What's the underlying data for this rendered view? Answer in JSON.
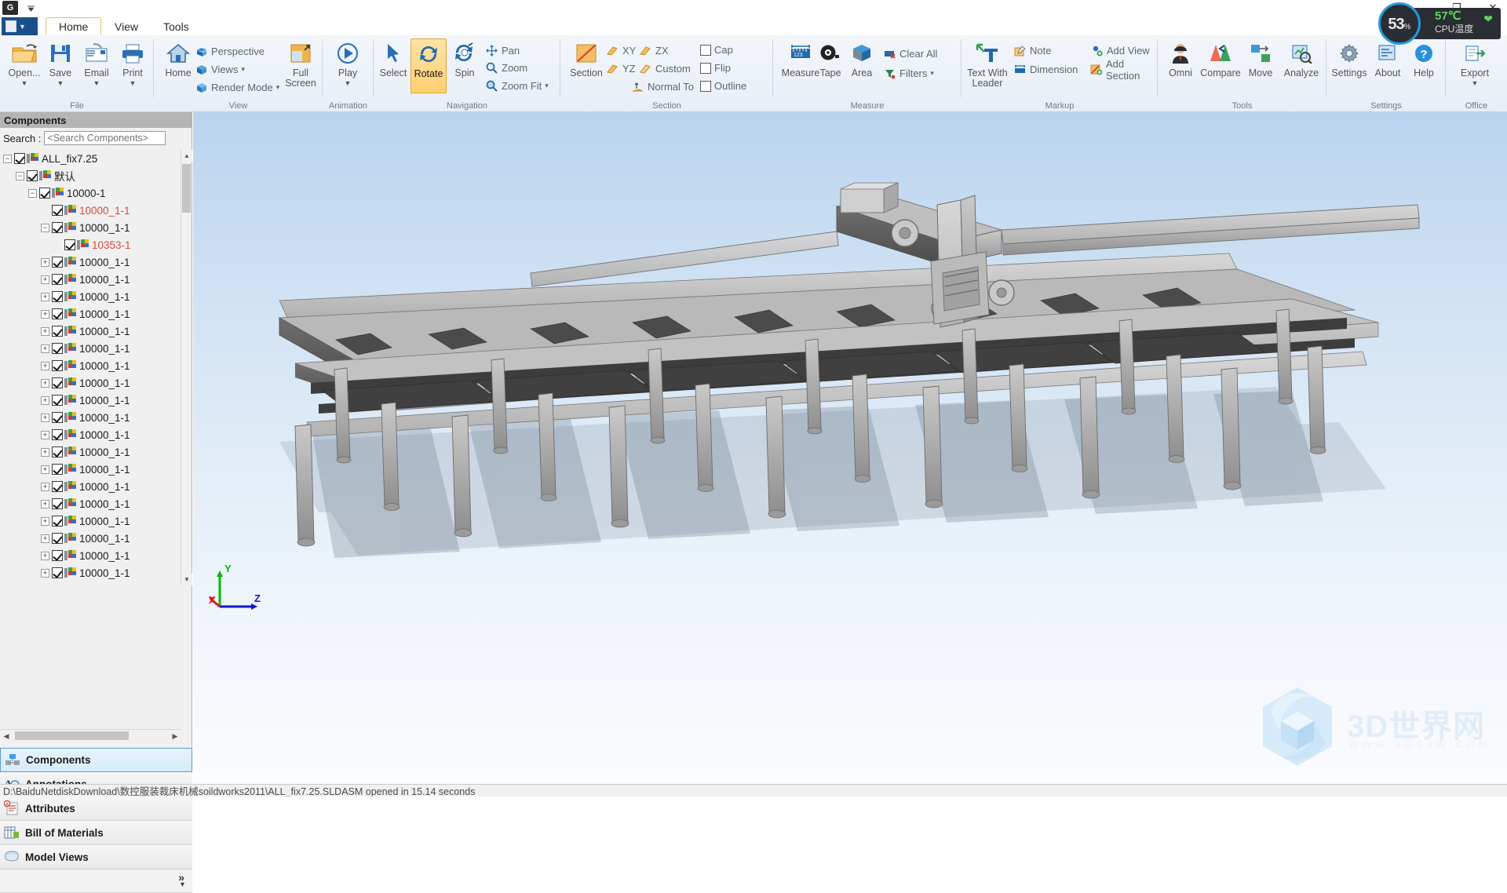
{
  "titlebar": {
    "app_menu_icon": "app-menu-icon",
    "qat_dropdown_icon": "chevron-down-icon",
    "minimize": "—",
    "maximize": "❐",
    "close": "✕"
  },
  "cpu_widget": {
    "percent": "53",
    "percent_symbol": "%",
    "temperature": "57℃",
    "label": "CPU温度",
    "leaf_icon": "leaf-icon",
    "ring_color": "#1f9bde",
    "temp_color": "#5fd35f"
  },
  "tabs": [
    {
      "label": "Home",
      "active": true
    },
    {
      "label": "View",
      "active": false
    },
    {
      "label": "Tools",
      "active": false
    }
  ],
  "ribbon": {
    "groups": [
      {
        "name": "File",
        "label": "File",
        "big_buttons": [
          {
            "label": "Open...",
            "icon": "open-folder-icon",
            "caret": "▼"
          },
          {
            "label": "Save",
            "icon": "save-disk-icon",
            "caret": "▼"
          },
          {
            "label": "Email",
            "icon": "email-icon",
            "caret": "▼"
          },
          {
            "label": "Print",
            "icon": "printer-icon",
            "caret": "▼"
          }
        ]
      },
      {
        "name": "View",
        "label": "View",
        "big_buttons": [
          {
            "label": "Home",
            "icon": "home-icon",
            "caret": ""
          },
          {
            "label": "Full Screen",
            "icon": "fullscreen-icon",
            "caret": ""
          }
        ],
        "small_buttons": [
          {
            "label": "Perspective",
            "icon": "perspective-icon",
            "caret": ""
          },
          {
            "label": "Views",
            "icon": "views-cube-icon",
            "caret": "▾"
          },
          {
            "label": "Render Mode",
            "icon": "render-mode-icon",
            "caret": "▾"
          }
        ]
      },
      {
        "name": "Animation",
        "label": "Animation",
        "big_buttons": [
          {
            "label": "Play",
            "icon": "play-icon",
            "caret": "▼"
          }
        ]
      },
      {
        "name": "Navigation",
        "label": "Navigation",
        "big_buttons": [
          {
            "label": "Select",
            "icon": "cursor-arrow-icon",
            "caret": "",
            "active": false
          },
          {
            "label": "Rotate",
            "icon": "rotate-icon",
            "caret": "",
            "active": true
          },
          {
            "label": "Spin",
            "icon": "spin-icon",
            "caret": "",
            "active": false
          }
        ],
        "small_buttons": [
          {
            "label": "Pan",
            "icon": "pan-icon",
            "caret": ""
          },
          {
            "label": "Zoom",
            "icon": "zoom-icon",
            "caret": ""
          },
          {
            "label": "Zoom Fit",
            "icon": "zoom-fit-icon",
            "caret": "▾"
          }
        ]
      },
      {
        "name": "Section",
        "label": "Section",
        "big_buttons": [
          {
            "label": "Section",
            "icon": "section-plane-icon",
            "caret": ""
          }
        ],
        "small_buttons": [
          {
            "label": "XY",
            "icon": "plane-xy-icon",
            "caret": ""
          },
          {
            "label": "ZX",
            "icon": "plane-zx-icon",
            "caret": ""
          },
          {
            "label": "YZ",
            "icon": "plane-yz-icon",
            "caret": ""
          },
          {
            "label": "Custom",
            "icon": "plane-custom-icon",
            "caret": ""
          },
          {
            "label": "Normal To",
            "icon": "normal-to-icon",
            "caret": ""
          }
        ],
        "checkboxes": [
          {
            "label": "Cap",
            "checked": false
          },
          {
            "label": "Flip",
            "checked": false
          },
          {
            "label": "Outline",
            "checked": false
          }
        ]
      },
      {
        "name": "Measure",
        "label": "Measure",
        "big_buttons": [
          {
            "label": "Measure",
            "icon": "measure-ruler-icon",
            "caret": ""
          },
          {
            "label": "Tape",
            "icon": "tape-icon",
            "caret": ""
          },
          {
            "label": "Area",
            "icon": "area-cube-icon",
            "caret": ""
          }
        ],
        "small_buttons": [
          {
            "label": "Clear All",
            "icon": "clear-all-icon",
            "caret": ""
          },
          {
            "label": "Filters",
            "icon": "filters-icon",
            "caret": "▾"
          }
        ]
      },
      {
        "name": "Markup",
        "label": "Markup",
        "big_buttons": [
          {
            "label": "Text With Leader",
            "icon": "text-with-leader-icon",
            "caret": ""
          }
        ],
        "small_buttons": [
          {
            "label": "Note",
            "icon": "note-icon",
            "caret": ""
          },
          {
            "label": "Dimension",
            "icon": "dimension-icon",
            "caret": ""
          },
          {
            "label": "Add View",
            "icon": "add-view-icon",
            "caret": ""
          },
          {
            "label": "Add Section",
            "icon": "add-section-icon",
            "caret": ""
          }
        ]
      },
      {
        "name": "Tools",
        "label": "Tools",
        "big_buttons": [
          {
            "label": "Omni",
            "icon": "omni-person-icon",
            "caret": ""
          },
          {
            "label": "Compare",
            "icon": "compare-icon",
            "caret": ""
          },
          {
            "label": "Move",
            "icon": "move-icon",
            "caret": ""
          },
          {
            "label": "Analyze",
            "icon": "analyze-icon",
            "caret": ""
          }
        ]
      },
      {
        "name": "Settings",
        "label": "Settings",
        "big_buttons": [
          {
            "label": "Settings",
            "icon": "settings-gear-icon",
            "caret": ""
          },
          {
            "label": "About",
            "icon": "about-icon",
            "caret": ""
          },
          {
            "label": "Help",
            "icon": "help-icon",
            "caret": ""
          }
        ]
      },
      {
        "name": "Office",
        "label": "Office",
        "big_buttons": [
          {
            "label": "Export",
            "icon": "export-icon",
            "caret": "▼"
          }
        ]
      }
    ]
  },
  "panel": {
    "title": "Components",
    "search_label": "Search :",
    "search_placeholder": "<Search Components>",
    "search_value": ""
  },
  "tree": [
    {
      "depth": 0,
      "expander": "−",
      "checked": true,
      "label": "ALL_fix7.25",
      "red": false
    },
    {
      "depth": 1,
      "expander": "−",
      "checked": true,
      "label": "默认",
      "red": false
    },
    {
      "depth": 2,
      "expander": "−",
      "checked": true,
      "label": "10000-1",
      "red": false
    },
    {
      "depth": 3,
      "expander": "",
      "checked": true,
      "label": "10000_1-1",
      "red": true
    },
    {
      "depth": 3,
      "expander": "−",
      "checked": true,
      "label": "10000_1-1",
      "red": false
    },
    {
      "depth": 4,
      "expander": "",
      "checked": true,
      "label": "10353-1",
      "red": true
    },
    {
      "depth": 3,
      "expander": "+",
      "checked": true,
      "label": "10000_1-1",
      "red": false
    },
    {
      "depth": 3,
      "expander": "+",
      "checked": true,
      "label": "10000_1-1",
      "red": false
    },
    {
      "depth": 3,
      "expander": "+",
      "checked": true,
      "label": "10000_1-1",
      "red": false
    },
    {
      "depth": 3,
      "expander": "+",
      "checked": true,
      "label": "10000_1-1",
      "red": false
    },
    {
      "depth": 3,
      "expander": "+",
      "checked": true,
      "label": "10000_1-1",
      "red": false
    },
    {
      "depth": 3,
      "expander": "+",
      "checked": true,
      "label": "10000_1-1",
      "red": false
    },
    {
      "depth": 3,
      "expander": "+",
      "checked": true,
      "label": "10000_1-1",
      "red": false
    },
    {
      "depth": 3,
      "expander": "+",
      "checked": true,
      "label": "10000_1-1",
      "red": false
    },
    {
      "depth": 3,
      "expander": "+",
      "checked": true,
      "label": "10000_1-1",
      "red": false
    },
    {
      "depth": 3,
      "expander": "+",
      "checked": true,
      "label": "10000_1-1",
      "red": false
    },
    {
      "depth": 3,
      "expander": "+",
      "checked": true,
      "label": "10000_1-1",
      "red": false
    },
    {
      "depth": 3,
      "expander": "+",
      "checked": true,
      "label": "10000_1-1",
      "red": false
    },
    {
      "depth": 3,
      "expander": "+",
      "checked": true,
      "label": "10000_1-1",
      "red": false
    },
    {
      "depth": 3,
      "expander": "+",
      "checked": true,
      "label": "10000_1-1",
      "red": false
    },
    {
      "depth": 3,
      "expander": "+",
      "checked": true,
      "label": "10000_1-1",
      "red": false
    },
    {
      "depth": 3,
      "expander": "+",
      "checked": true,
      "label": "10000_1-1",
      "red": false
    },
    {
      "depth": 3,
      "expander": "+",
      "checked": true,
      "label": "10000_1-1",
      "red": false
    },
    {
      "depth": 3,
      "expander": "+",
      "checked": true,
      "label": "10000_1-1",
      "red": false
    },
    {
      "depth": 3,
      "expander": "+",
      "checked": true,
      "label": "10000_1-1",
      "red": false
    }
  ],
  "panel_tabs": [
    {
      "label": "Components",
      "icon": "components-icon",
      "selected": true
    },
    {
      "label": "Annotations",
      "icon": "annotations-icon",
      "selected": false
    },
    {
      "label": "Attributes",
      "icon": "attributes-icon",
      "selected": false
    },
    {
      "label": "Bill of Materials",
      "icon": "bom-icon",
      "selected": false
    },
    {
      "label": "Model Views",
      "icon": "model-views-icon",
      "selected": false
    }
  ],
  "panel_more": {
    "chevron": "»",
    "caret": "▾"
  },
  "viewport": {
    "axis": {
      "x": "X",
      "y": "Y",
      "z": "Z",
      "x_color": "#e01b1b",
      "y_color": "#00bb00",
      "z_color": "#1414c8"
    },
    "watermark_text": "3D世界网",
    "watermark_sub": "WWW.3DSJW.COM",
    "model_description": "Gray shaded CNC garment cutting-table gantry machine assembly"
  },
  "statusbar": {
    "text": "D:\\BaiduNetdiskDownload\\数控服装裁床机械soildworks2011\\ALL_fix7.25.SLDASM opened in 15.14 seconds"
  }
}
